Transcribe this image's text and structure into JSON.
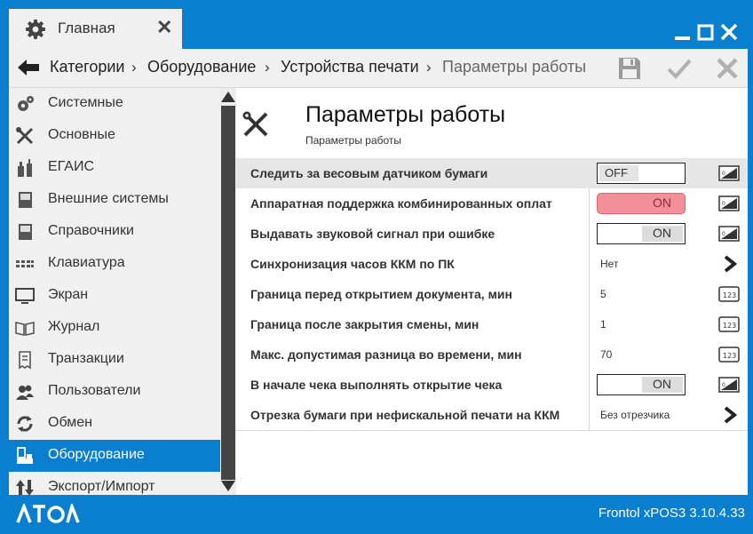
{
  "titlebar": {
    "tab_label": "Главная",
    "icons": [
      "gear-icon",
      "close-icon",
      "minimize-icon",
      "maximize-icon",
      "window-close-icon"
    ]
  },
  "navbar": {
    "breadcrumbs": [
      "Категории",
      "Оборудование",
      "Устройства печати",
      "Параметры работы"
    ],
    "separator": "›",
    "icons": [
      "back-arrow-icon",
      "save-icon",
      "checkmark-icon",
      "close-icon"
    ]
  },
  "sidebar": {
    "items": [
      {
        "label": "Системные",
        "icon": "system-gears-icon"
      },
      {
        "label": "Основные",
        "icon": "tools-icon"
      },
      {
        "label": "ЕГАИС",
        "icon": "bottles-icon"
      },
      {
        "label": "Внешние системы",
        "icon": "book-icon"
      },
      {
        "label": "Справочники",
        "icon": "reference-book-icon"
      },
      {
        "label": "Клавиатура",
        "icon": "keyboard-icon"
      },
      {
        "label": "Экран",
        "icon": "monitor-icon"
      },
      {
        "label": "Журнал",
        "icon": "journal-icon"
      },
      {
        "label": "Транзакции",
        "icon": "receipt-icon"
      },
      {
        "label": "Пользователи",
        "icon": "users-icon"
      },
      {
        "label": "Обмен",
        "icon": "sync-icon"
      },
      {
        "label": "Оборудование",
        "icon": "pos-terminal-icon",
        "active": true
      },
      {
        "label": "Экспорт/Импорт",
        "icon": "export-import-icon"
      }
    ]
  },
  "main": {
    "title": "Параметры работы",
    "subtitle": "Параметры работы",
    "rows": [
      {
        "name": "Следить за весовым датчиком бумаги",
        "type": "toggle",
        "state": "OFF",
        "icon": "toggle-setting-icon"
      },
      {
        "name": "Аппаратная поддержка комбинированных оплат",
        "type": "toggle",
        "state": "ON",
        "icon": "toggle-setting-icon"
      },
      {
        "name": "Выдавать звуковой сигнал при ошибке",
        "type": "toggle",
        "state": "ON",
        "icon": "toggle-setting-icon"
      },
      {
        "name": "Синхронизация часов ККМ по ПК",
        "type": "select",
        "value": "Нет",
        "icon": "chevron-right-icon"
      },
      {
        "name": "Граница перед открытием документа, мин",
        "type": "number",
        "value": "5",
        "icon": "numeric-input-icon"
      },
      {
        "name": "Граница после закрытия смены, мин",
        "type": "number",
        "value": "1",
        "icon": "numeric-input-icon"
      },
      {
        "name": "Макс. допустимая разница во времени, мин",
        "type": "number",
        "value": "70",
        "icon": "numeric-input-icon"
      },
      {
        "name": "В начале чека выполнять открытие чека",
        "type": "toggle",
        "state": "ON",
        "icon": "toggle-setting-icon"
      },
      {
        "name": "Отрезка бумаги при нефискальной печати на ККМ",
        "type": "select",
        "value": "Без отрезчика",
        "icon": "chevron-right-icon"
      }
    ]
  },
  "footer": {
    "logo": "АТОЛ",
    "version": "Frontol xPOS3 3.10.4.33"
  },
  "colors": {
    "accent": "#0a7fd0",
    "panel": "#f0f0f0",
    "highlight": "#f2909a"
  }
}
